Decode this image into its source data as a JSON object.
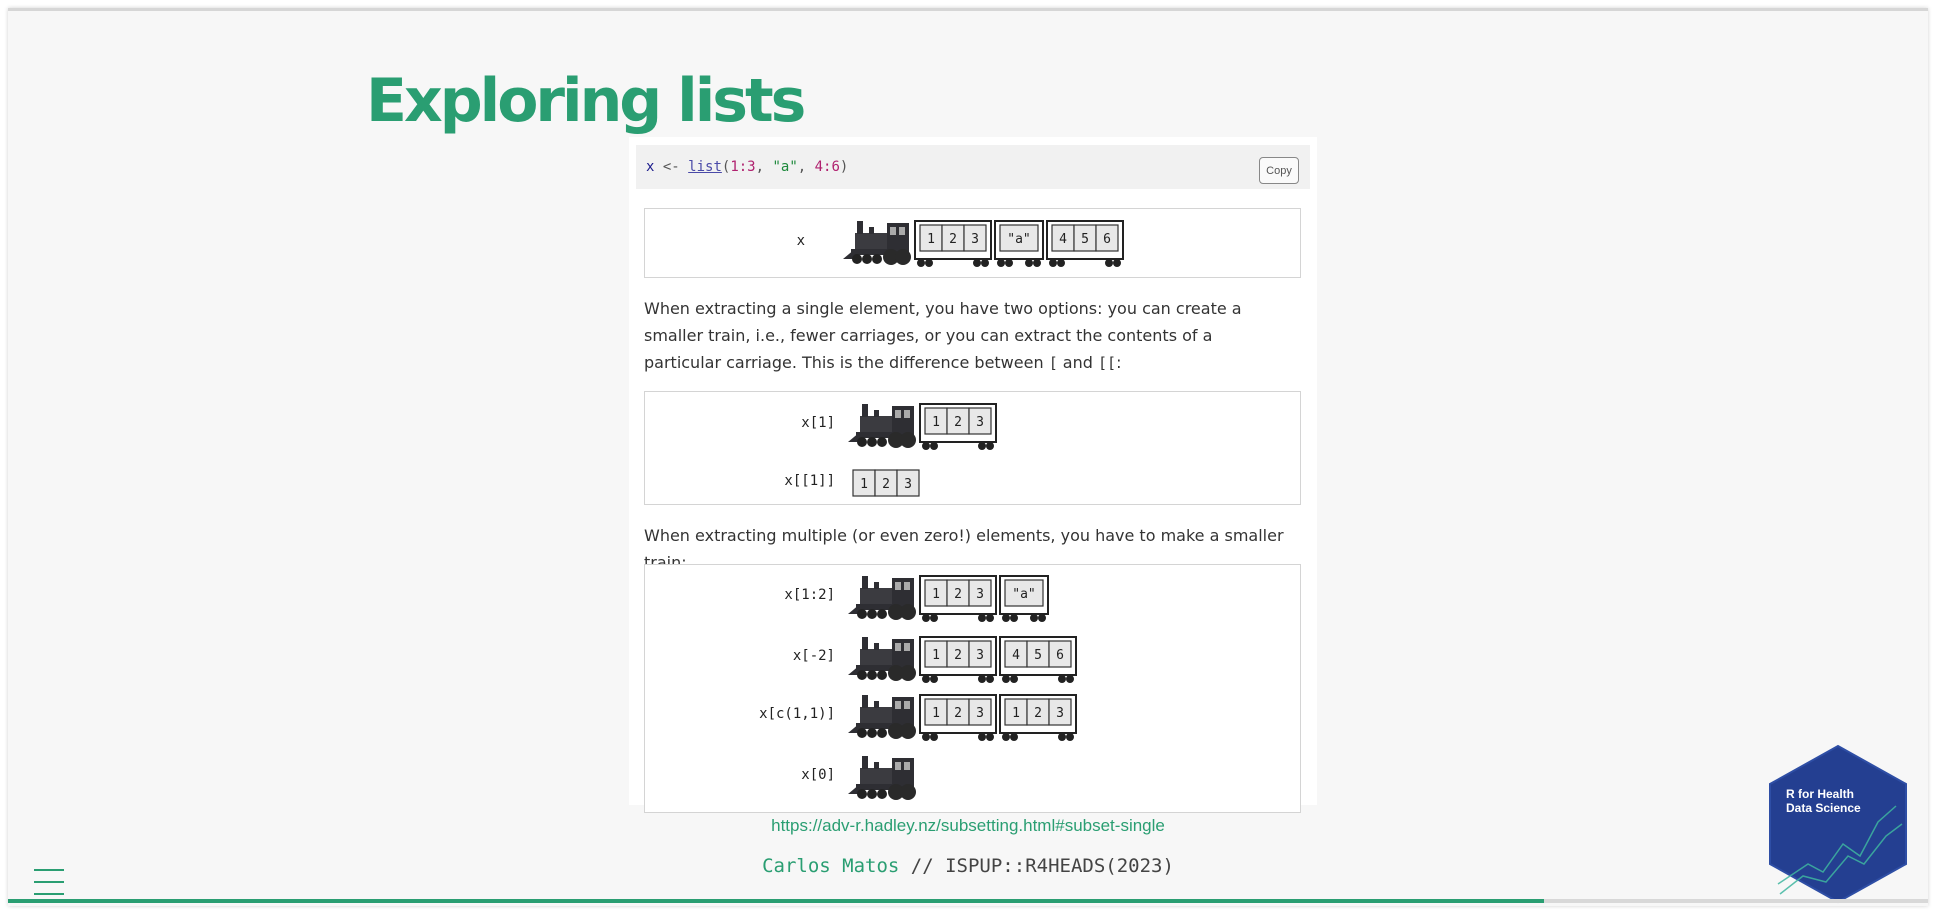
{
  "slide": {
    "title": "Exploring lists",
    "code": {
      "var": "x",
      "arrow": " <- ",
      "fn": "list",
      "open": "(",
      "n1": "1:3",
      "sep1": ", ",
      "str": "\"a\"",
      "sep2": ", ",
      "n2": "4:6",
      "close": ")"
    },
    "copy_label": "Copy",
    "para1_a": "When extracting a single element, you have two options: you can create a smaller train, i.e., fewer carriages, or you can extract the contents of a particular carriage. This is the difference between ",
    "para1_op1": "[",
    "para1_and": " and ",
    "para1_op2": "[[",
    "para1_end": ":",
    "para2": "When extracting multiple (or even zero!) elements, you have to make a smaller train:",
    "diagram1": {
      "label": "x",
      "carriages": [
        [
          "1",
          "2",
          "3"
        ],
        [
          "\"a\""
        ],
        [
          "4",
          "5",
          "6"
        ]
      ]
    },
    "diagram2": [
      {
        "label": "x[1]",
        "carriages": [
          [
            "1",
            "2",
            "3"
          ]
        ],
        "engine": true
      },
      {
        "label": "x[[1]]",
        "carriages": [
          [
            "1",
            "2",
            "3"
          ]
        ],
        "engine": false
      }
    ],
    "diagram3": [
      {
        "label": "x[1:2]",
        "carriages": [
          [
            "1",
            "2",
            "3"
          ],
          [
            "\"a\""
          ]
        ]
      },
      {
        "label": "x[-2]",
        "carriages": [
          [
            "1",
            "2",
            "3"
          ],
          [
            "4",
            "5",
            "6"
          ]
        ]
      },
      {
        "label": "x[c(1,1)]",
        "carriages": [
          [
            "1",
            "2",
            "3"
          ],
          [
            "1",
            "2",
            "3"
          ]
        ]
      },
      {
        "label": "x[0]",
        "carriages": []
      }
    ],
    "source_link": "https://adv-r.hadley.nz/subsetting.html#subset-single",
    "footer_name": "Carlos Matos",
    "footer_rest": " // ISPUP::R4HEADS(2023)",
    "logo_line1": "R for Health",
    "logo_line2": "Data Science",
    "progress": 0.8
  },
  "colors": {
    "accent": "#2a9e72",
    "logo_bg": "#243f91"
  }
}
